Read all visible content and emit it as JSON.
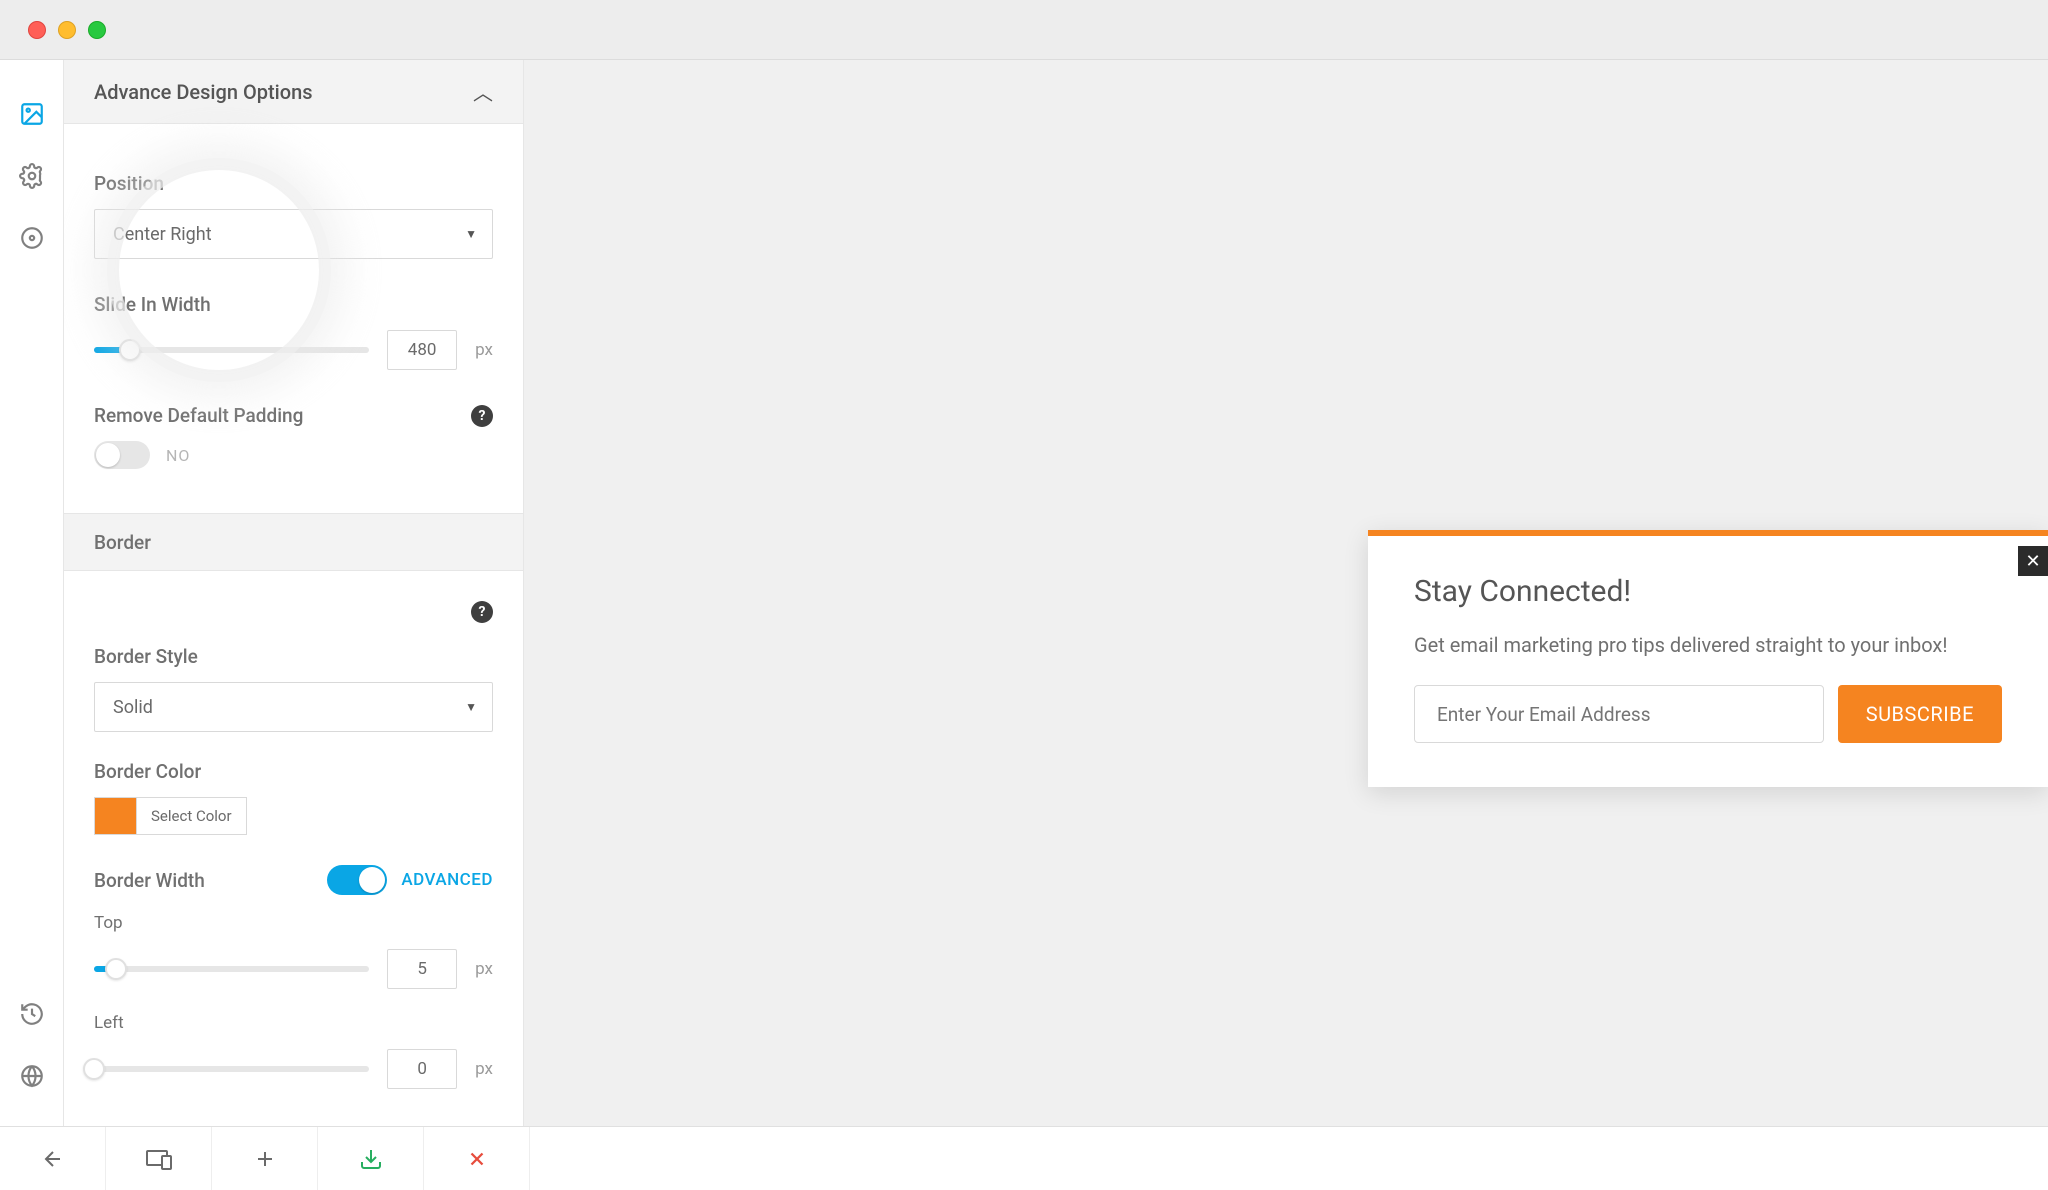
{
  "colors": {
    "accent": "#0aa6e5",
    "brand": "#f58420"
  },
  "sidebar_header": "Advance Design Options",
  "position": {
    "label": "Position",
    "value": "Center Right"
  },
  "slide_in_width": {
    "label": "Slide In Width",
    "value": "480",
    "unit": "px",
    "percent": 13
  },
  "remove_padding": {
    "label": "Remove Default Padding",
    "off_label": "NO",
    "on": false
  },
  "border_section": "Border",
  "border_style": {
    "label": "Border Style",
    "value": "Solid"
  },
  "border_color": {
    "label": "Border Color",
    "btn": "Select Color",
    "hex": "#f58420"
  },
  "border_width": {
    "label": "Border Width",
    "advanced_label": "ADVANCED",
    "advanced_on": true,
    "top_label": "Top",
    "top_value": "5",
    "top_percent": 8,
    "left_label": "Left",
    "left_value": "0",
    "left_percent": 0,
    "unit": "px"
  },
  "popup": {
    "title": "Stay Connected!",
    "desc": "Get email marketing pro tips delivered straight to your inbox!",
    "placeholder": "Enter Your Email Address",
    "cta": "SUBSCRIBE"
  }
}
